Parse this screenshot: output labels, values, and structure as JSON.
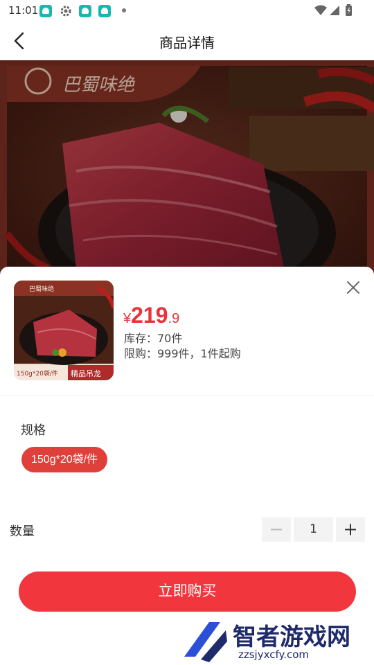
{
  "status_bar": {
    "time": "11:01"
  },
  "nav": {
    "title": "商品详情",
    "back_icon": "chevron-left-icon"
  },
  "hero": {
    "brand": "巴蜀味绝"
  },
  "product": {
    "thumb_brand": "巴蜀味绝",
    "thumb_tag": "150g*20袋/件",
    "thumb_name": "精品吊龙",
    "price_currency": "¥",
    "price_int": "219",
    "price_dec": ".9",
    "stock": "库存：70件",
    "limit": "限购：999件，1件起购"
  },
  "spec": {
    "label": "规格",
    "options": [
      "150g*20袋/件"
    ],
    "selected": "150g*20袋/件"
  },
  "quantity": {
    "label": "数量",
    "value": "1"
  },
  "buy_button": {
    "label": "立即购买"
  },
  "watermark": {
    "text": "智者游戏网",
    "url": "zzsjyxcfy.com"
  },
  "colors": {
    "accent": "#f2363e",
    "chip": "#e0403a",
    "price": "#e9323b"
  }
}
